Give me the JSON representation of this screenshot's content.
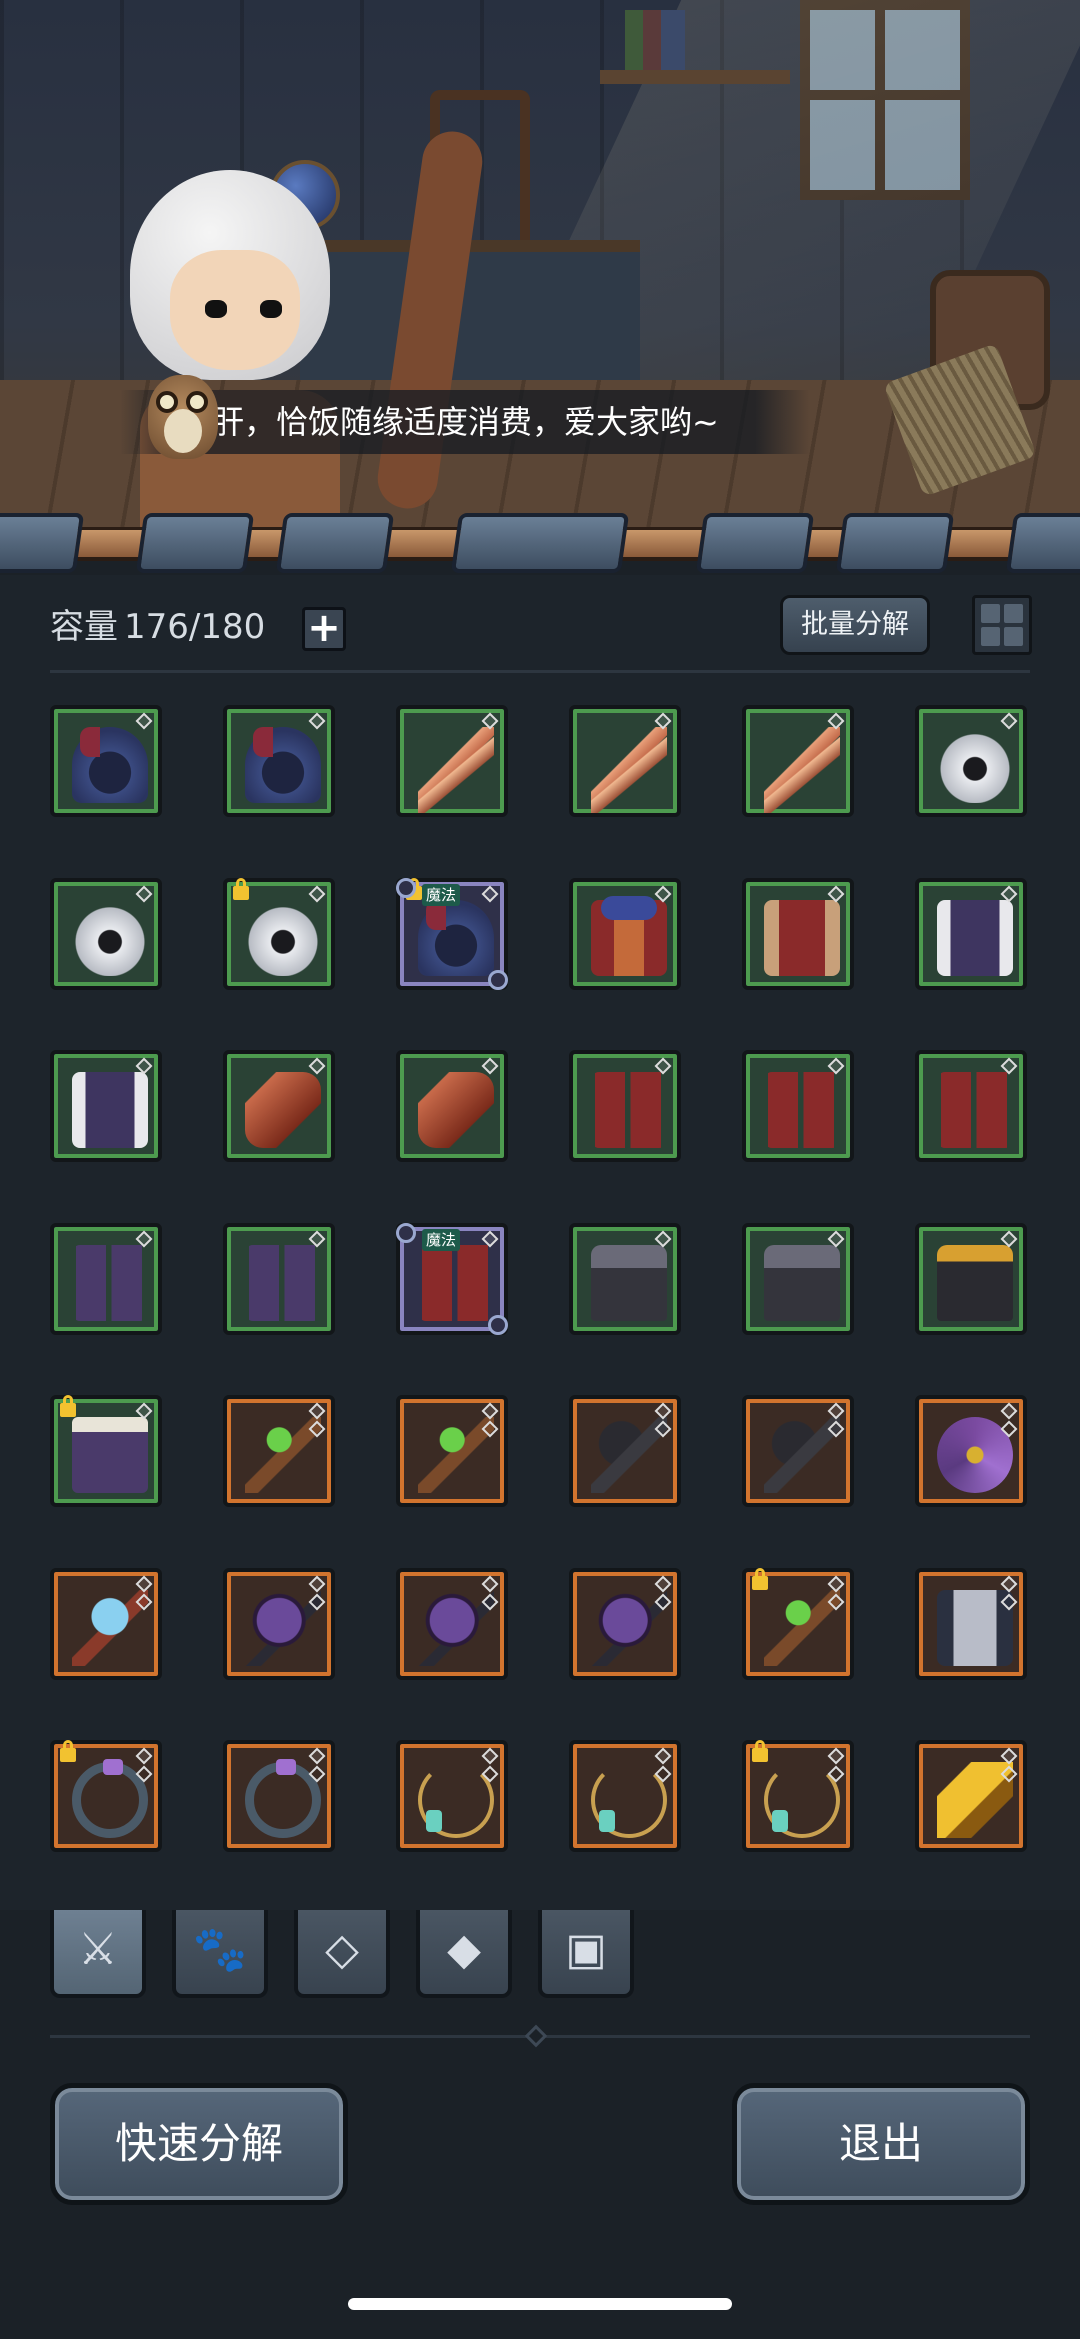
{
  "scene": {
    "dialogue": "护肝，恰饭随缘适度消费，爱大家哟~"
  },
  "inventory": {
    "capacity_label": "容量",
    "capacity_value": "176/180",
    "add_label": "+",
    "batch_button": "批量分解",
    "slots": [
      {
        "item": "hood",
        "rarity": "green",
        "locked": false,
        "magic": false,
        "class": "i-hood"
      },
      {
        "item": "hood",
        "rarity": "green",
        "locked": false,
        "magic": false,
        "class": "i-hood"
      },
      {
        "item": "quill",
        "rarity": "green",
        "locked": false,
        "magic": false,
        "class": "i-quill"
      },
      {
        "item": "quill",
        "rarity": "green",
        "locked": false,
        "magic": false,
        "class": "i-quill"
      },
      {
        "item": "quill",
        "rarity": "green",
        "locked": false,
        "magic": false,
        "class": "i-quill"
      },
      {
        "item": "horned-helm",
        "rarity": "green",
        "locked": false,
        "magic": false,
        "class": "i-helm"
      },
      {
        "item": "horned-helm",
        "rarity": "green",
        "locked": false,
        "magic": false,
        "class": "i-helm"
      },
      {
        "item": "horned-helm",
        "rarity": "green",
        "locked": true,
        "magic": false,
        "class": "i-helm"
      },
      {
        "item": "hood",
        "rarity": "purple",
        "locked": true,
        "magic": true,
        "class": "i-hood"
      },
      {
        "item": "robe",
        "rarity": "green",
        "locked": false,
        "magic": false,
        "class": "i-robe"
      },
      {
        "item": "tunic",
        "rarity": "green",
        "locked": false,
        "magic": false,
        "class": "i-vest2"
      },
      {
        "item": "vest",
        "rarity": "green",
        "locked": false,
        "magic": false,
        "class": "i-vest"
      },
      {
        "item": "vest",
        "rarity": "green",
        "locked": false,
        "magic": false,
        "class": "i-vest"
      },
      {
        "item": "bracer",
        "rarity": "green",
        "locked": false,
        "magic": false,
        "class": "i-bracer"
      },
      {
        "item": "bracer",
        "rarity": "green",
        "locked": false,
        "magic": false,
        "class": "i-bracer"
      },
      {
        "item": "boots",
        "rarity": "green",
        "locked": false,
        "magic": false,
        "class": "i-boots"
      },
      {
        "item": "boots",
        "rarity": "green",
        "locked": false,
        "magic": false,
        "class": "i-boots"
      },
      {
        "item": "boots",
        "rarity": "green",
        "locked": false,
        "magic": false,
        "class": "i-boots"
      },
      {
        "item": "fur-boots",
        "rarity": "green",
        "locked": false,
        "magic": false,
        "class": "i-boots2"
      },
      {
        "item": "fur-boots",
        "rarity": "green",
        "locked": false,
        "magic": false,
        "class": "i-boots2"
      },
      {
        "item": "boots",
        "rarity": "purple",
        "locked": false,
        "magic": true,
        "class": "i-boots"
      },
      {
        "item": "pants",
        "rarity": "green",
        "locked": false,
        "magic": false,
        "class": "i-pants"
      },
      {
        "item": "pants",
        "rarity": "green",
        "locked": false,
        "magic": false,
        "class": "i-pants"
      },
      {
        "item": "gold-pants",
        "rarity": "green",
        "locked": false,
        "magic": false,
        "class": "i-pants2"
      },
      {
        "item": "cape",
        "rarity": "green",
        "locked": true,
        "magic": false,
        "class": "i-cape"
      },
      {
        "item": "staff",
        "rarity": "orange",
        "locked": false,
        "magic": false,
        "class": "i-staff"
      },
      {
        "item": "staff",
        "rarity": "orange",
        "locked": false,
        "magic": false,
        "class": "i-staff"
      },
      {
        "item": "hammer",
        "rarity": "orange",
        "locked": false,
        "magic": false,
        "class": "i-hammer"
      },
      {
        "item": "hammer",
        "rarity": "orange",
        "locked": false,
        "magic": false,
        "class": "i-hammer"
      },
      {
        "item": "wand",
        "rarity": "orange",
        "locked": false,
        "magic": false,
        "class": "i-wand"
      },
      {
        "item": "ice-scepter",
        "rarity": "orange",
        "locked": false,
        "magic": false,
        "class": "i-ice"
      },
      {
        "item": "mace",
        "rarity": "orange",
        "locked": false,
        "magic": false,
        "class": "i-mace"
      },
      {
        "item": "mace",
        "rarity": "orange",
        "locked": false,
        "magic": false,
        "class": "i-mace"
      },
      {
        "item": "mace",
        "rarity": "orange",
        "locked": false,
        "magic": false,
        "class": "i-mace"
      },
      {
        "item": "staff",
        "rarity": "orange",
        "locked": true,
        "magic": false,
        "class": "i-staff"
      },
      {
        "item": "coat",
        "rarity": "orange",
        "locked": false,
        "magic": false,
        "class": "i-coat"
      },
      {
        "item": "ring",
        "rarity": "orange",
        "locked": true,
        "magic": false,
        "class": "i-ring"
      },
      {
        "item": "ring",
        "rarity": "orange",
        "locked": false,
        "magic": false,
        "class": "i-ring"
      },
      {
        "item": "necklace",
        "rarity": "orange",
        "locked": false,
        "magic": false,
        "class": "i-neck"
      },
      {
        "item": "necklace",
        "rarity": "orange",
        "locked": false,
        "magic": false,
        "class": "i-neck"
      },
      {
        "item": "necklace",
        "rarity": "orange",
        "locked": true,
        "magic": false,
        "class": "i-neck"
      },
      {
        "item": "gold-shard",
        "rarity": "orange",
        "locked": false,
        "magic": false,
        "class": "i-shard"
      }
    ],
    "magic_label": "魔法"
  },
  "tabs": [
    {
      "name": "equipment",
      "icon": "sword-icon",
      "glyph": "⚔",
      "active": true
    },
    {
      "name": "pet",
      "icon": "paw-icon",
      "glyph": "🐾",
      "active": false
    },
    {
      "name": "gem",
      "icon": "diamond-icon",
      "glyph": "◇",
      "active": false
    },
    {
      "name": "material",
      "icon": "ore-icon",
      "glyph": "◆",
      "active": false
    },
    {
      "name": "chest",
      "icon": "chest-icon",
      "glyph": "▣",
      "active": false
    }
  ],
  "buttons": {
    "quick_decompose": "快速分解",
    "exit": "退出"
  },
  "colors": {
    "rarity_green": "#4d9b4f",
    "rarity_orange": "#d2742e",
    "rarity_purple": "#8a85c0",
    "panel_bg": "#1d242b"
  }
}
